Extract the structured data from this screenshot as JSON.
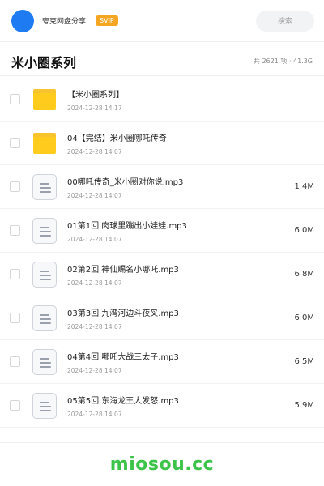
{
  "header": {
    "app_name": "夸克网盘分享",
    "badge": "SVIP",
    "search_placeholder": "搜索"
  },
  "folder": {
    "title": "米小圈系列",
    "summary": "共 2621 项 · 41.3G"
  },
  "files": [
    {
      "type": "folder",
      "name": "【米小圈系列】",
      "date": "2024-12-28 14:17",
      "size": ""
    },
    {
      "type": "folder",
      "name": "04【完结】米小圈哪吒传奇",
      "date": "2024-12-28 14:07",
      "size": ""
    },
    {
      "type": "file",
      "name": "00哪吒传奇_米小圈对你说.mp3",
      "date": "2024-12-28 14:07",
      "size": "1.4M"
    },
    {
      "type": "file",
      "name": "01第1回 肉球里蹦出小娃娃.mp3",
      "date": "2024-12-28 14:07",
      "size": "6.0M"
    },
    {
      "type": "file",
      "name": "02第2回 神仙赐名小哪吒.mp3",
      "date": "2024-12-28 14:07",
      "size": "6.8M"
    },
    {
      "type": "file",
      "name": "03第3回 九湾河边斗夜叉.mp3",
      "date": "2024-12-28 14:07",
      "size": "6.0M"
    },
    {
      "type": "file",
      "name": "04第4回 哪吒大战三太子.mp3",
      "date": "2024-12-28 14:07",
      "size": "6.5M"
    },
    {
      "type": "file",
      "name": "05第5回 东海龙王大发怒.mp3",
      "date": "2024-12-28 14:07",
      "size": "5.9M"
    }
  ],
  "footer": {
    "watermark": "miosou.cc"
  },
  "colors": {
    "accent_blue": "#1e7bf2",
    "svip_orange": "#f5a623",
    "folder_yellow": "#ffcc1d",
    "brand_green": "#3cc44a"
  }
}
